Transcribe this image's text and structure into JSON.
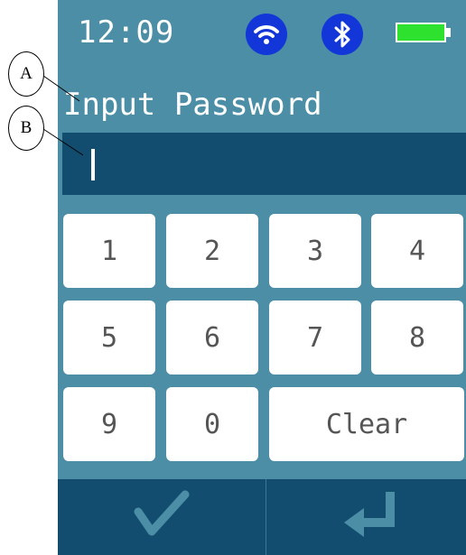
{
  "status_bar": {
    "time": "12:09",
    "battery_level": 1.0,
    "icons": [
      "wifi-icon",
      "bluetooth-icon",
      "battery-icon"
    ]
  },
  "prompt": "Input Password",
  "password_field": {
    "value": ""
  },
  "keypad": {
    "keys": [
      "1",
      "2",
      "3",
      "4",
      "5",
      "6",
      "7",
      "8",
      "9",
      "0",
      "Clear"
    ]
  },
  "bottom_bar": {
    "confirm_icon": "checkmark-icon",
    "enter_icon": "enter-return-icon"
  },
  "callouts": {
    "a": "A",
    "b": "B"
  },
  "colors": {
    "screen_background": "#4b8ea6",
    "dark_panel": "#124d70",
    "status_icon_background": "#1236d8",
    "battery_fill": "#2ee12e",
    "key_background": "#ffffff",
    "key_text": "#555555"
  }
}
